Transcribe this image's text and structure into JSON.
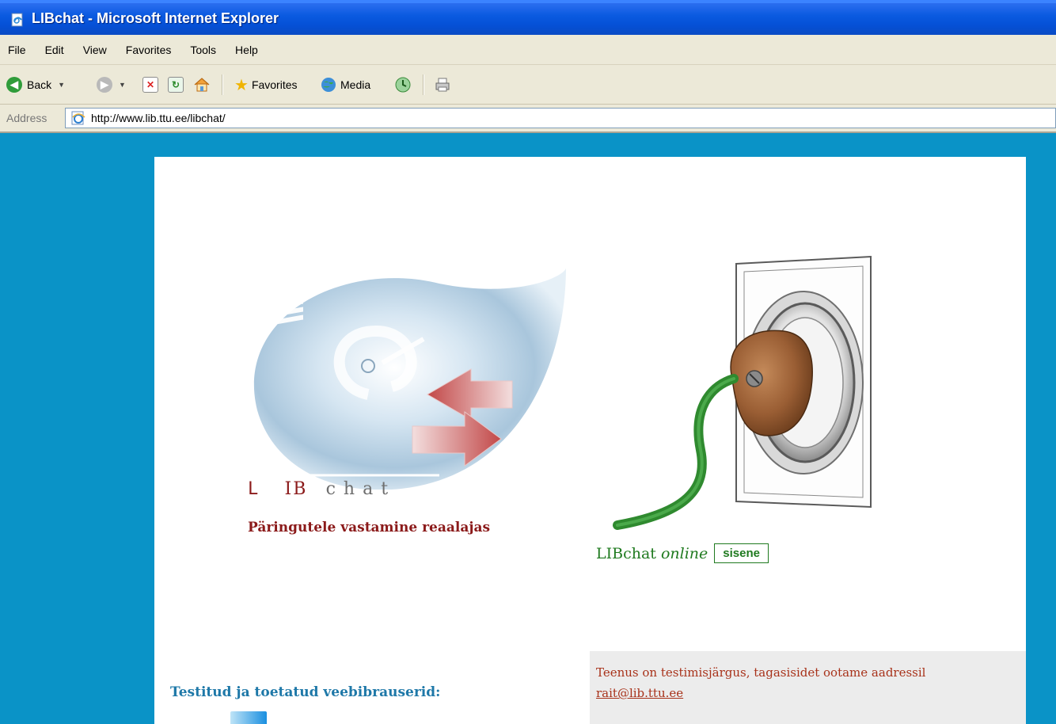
{
  "window": {
    "title": "LIBchat - Microsoft Internet Explorer",
    "icon": "ie-page-icon"
  },
  "menu": [
    "File",
    "Edit",
    "View",
    "Favorites",
    "Tools",
    "Help"
  ],
  "toolbar": {
    "back_label": "Back",
    "favorites_label": "Favorites",
    "media_label": "Media"
  },
  "address": {
    "label": "Address",
    "url": "http://www.lib.ttu.ee/libchat/"
  },
  "page": {
    "logo": {
      "letter_l": "L",
      "letters_ib": "IB",
      "letters_chat": "chat"
    },
    "tagline": "Päringutele vastamine reaalajas",
    "online": {
      "name": "LIBchat",
      "status": "online",
      "button_label": "sisene"
    },
    "notice": {
      "text": "Teenus on testimisjärgus, tagasisidet ootame aadressil",
      "email": "rait@lib.ttu.ee"
    },
    "browsers_title": "Testitud ja toetatud veebibrauserid:"
  },
  "colors": {
    "background": "#0a93c7",
    "title_bar": "#0a5ae0",
    "brand_red": "#8b1a1a",
    "online_green": "#1f7a1f",
    "notice_text": "#a8321a",
    "browsers_blue": "#1e78a8"
  }
}
